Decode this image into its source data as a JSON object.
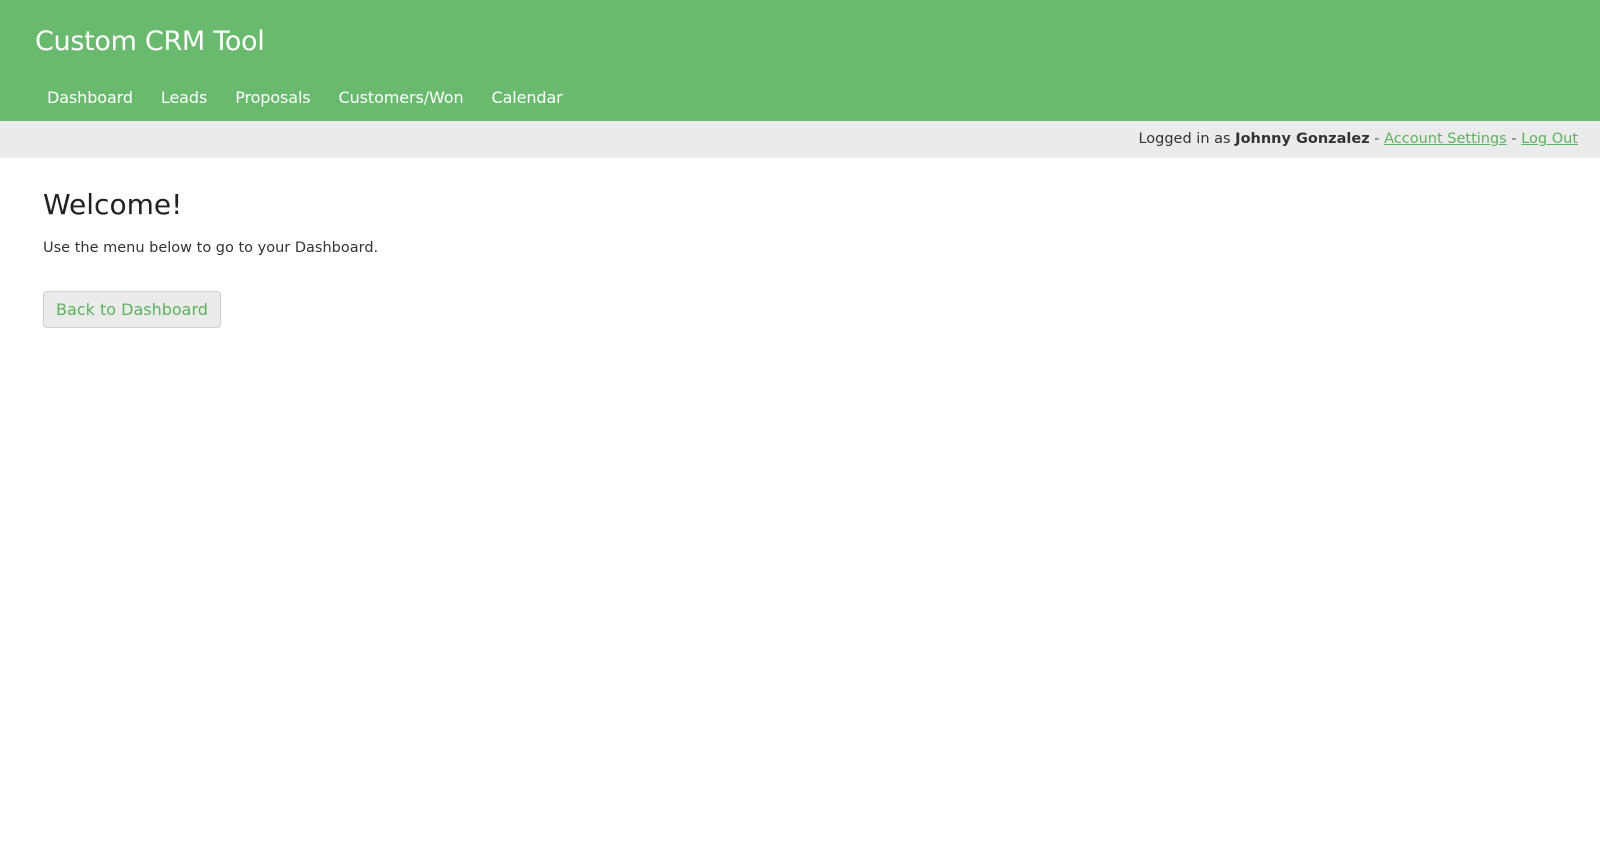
{
  "header": {
    "title": "Custom CRM Tool",
    "background": "#69b96f",
    "nav": [
      {
        "label": "Dashboard"
      },
      {
        "label": "Leads"
      },
      {
        "label": "Proposals"
      },
      {
        "label": "Customers/Won"
      },
      {
        "label": "Calendar"
      }
    ]
  },
  "userbar": {
    "prefix": "Logged in as ",
    "username": "Johnny Gonzalez",
    "separator": " - ",
    "account_settings": "Account Settings",
    "log_out": "Log Out",
    "link_color": "#5cb15f"
  },
  "main": {
    "heading": "Welcome!",
    "intro": "Use the menu below to go to your Dashboard.",
    "back_button": "Back to Dashboard"
  }
}
